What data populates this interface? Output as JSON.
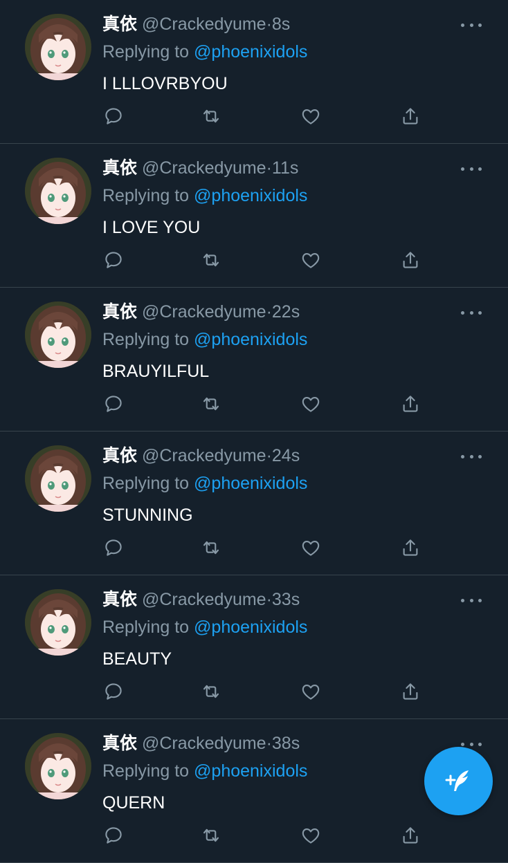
{
  "colors": {
    "background": "#15202b",
    "text": "#ffffff",
    "muted": "#8899a6",
    "accent": "#1da1f2",
    "divider": "#38444d",
    "fab": "#1da1f2"
  },
  "icons": {
    "reply": "reply-icon",
    "retweet": "retweet-icon",
    "like": "heart-icon",
    "share": "share-icon",
    "more": "more-icon",
    "compose": "compose-tweet-icon"
  },
  "tweets": [
    {
      "name": "真依",
      "handle": "@Crackedyume",
      "sep": "·",
      "time": "8s",
      "replying_prefix": "Replying to",
      "replying_to": "@phoenixidols",
      "text": "I LLLOVRBYOU"
    },
    {
      "name": "真依",
      "handle": "@Crackedyume",
      "sep": "·",
      "time": "11s",
      "replying_prefix": "Replying to",
      "replying_to": "@phoenixidols",
      "text": "I LOVE YOU"
    },
    {
      "name": "真依",
      "handle": "@Crackedyume",
      "sep": "·",
      "time": "22s",
      "replying_prefix": "Replying to",
      "replying_to": "@phoenixidols",
      "text": "BRAUYILFUL"
    },
    {
      "name": "真依",
      "handle": "@Crackedyume",
      "sep": "·",
      "time": "24s",
      "replying_prefix": "Replying to",
      "replying_to": "@phoenixidols",
      "text": "STUNNING"
    },
    {
      "name": "真依",
      "handle": "@Crackedyume",
      "sep": "·",
      "time": "33s",
      "replying_prefix": "Replying to",
      "replying_to": "@phoenixidols",
      "text": "BEAUTY"
    },
    {
      "name": "真依",
      "handle": "@Crackedyume",
      "sep": "·",
      "time": "38s",
      "replying_prefix": "Replying to",
      "replying_to": "@phoenixidols",
      "text": "QUERN"
    }
  ]
}
